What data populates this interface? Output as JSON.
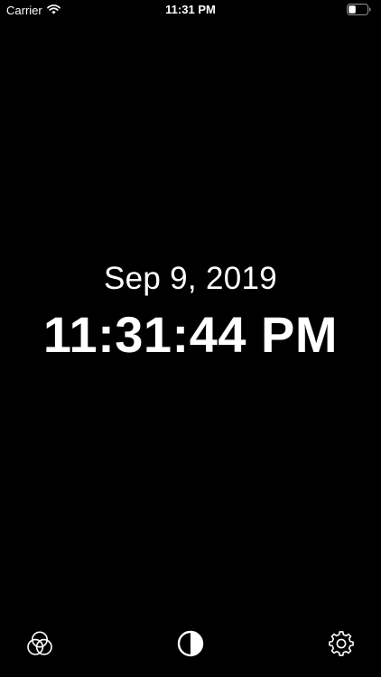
{
  "status_bar": {
    "carrier": "Carrier",
    "time": "11:31 PM",
    "icons": [
      "wifi-icon",
      "battery-icon"
    ]
  },
  "clock": {
    "date": "Sep 9, 2019",
    "time": "11:31:44 PM"
  },
  "toolbar": {
    "items": [
      {
        "name": "color-filter",
        "icon": "color-circles-icon"
      },
      {
        "name": "contrast",
        "icon": "contrast-icon"
      },
      {
        "name": "settings",
        "icon": "gear-icon"
      }
    ]
  },
  "colors": {
    "background": "#000000",
    "foreground": "#ffffff"
  }
}
